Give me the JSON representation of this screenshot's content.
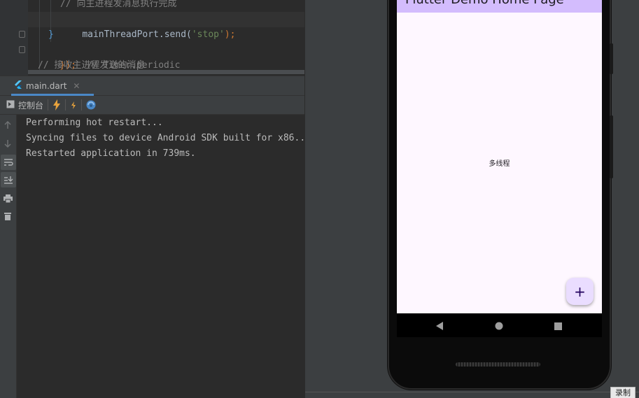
{
  "editor": {
    "lines": [
      {
        "comment": "// 向主进程发消息执行完成"
      },
      {
        "code": "mainThreadPort.send(",
        "str": "'stop'",
        "punct": ");"
      },
      {
        "brace": "}"
      },
      {
        "close": "});",
        "comment": "  // Timer.periodic"
      },
      {
        "comment": "// 接收主进程发送的消息"
      }
    ]
  },
  "tabs": [
    {
      "label": "main.dart",
      "icon": "flutter-icon",
      "active": true
    }
  ],
  "run_toolbar": {
    "console_label": "控制台",
    "icons": [
      "console-icon",
      "hot-reload-icon",
      "hot-restart-icon",
      "devtools-icon"
    ]
  },
  "side_actions": [
    "scroll-up-icon",
    "scroll-down-icon",
    "soft-wrap-icon",
    "scroll-to-end-icon",
    "print-icon",
    "clear-all-icon"
  ],
  "console": {
    "lines": [
      "Performing hot restart...",
      "Syncing files to device Android SDK built for x86...",
      "Restarted application in 739ms."
    ]
  },
  "emulator": {
    "appbar_title": "Flutter Demo Home Page",
    "center_text": "多线程",
    "fab_label": "+",
    "fab_icon": "add-icon",
    "nav_icons": [
      "back-icon",
      "home-icon",
      "recents-icon"
    ]
  },
  "record_badge": "录制",
  "colors": {
    "ide_bg": "#2b2b2b",
    "panel_bg": "#3c3f41",
    "appbar": "#d3bcfd",
    "screen_bg": "#fef7ff",
    "fab_bg": "#eaddff",
    "accent": "#4a88c7"
  }
}
